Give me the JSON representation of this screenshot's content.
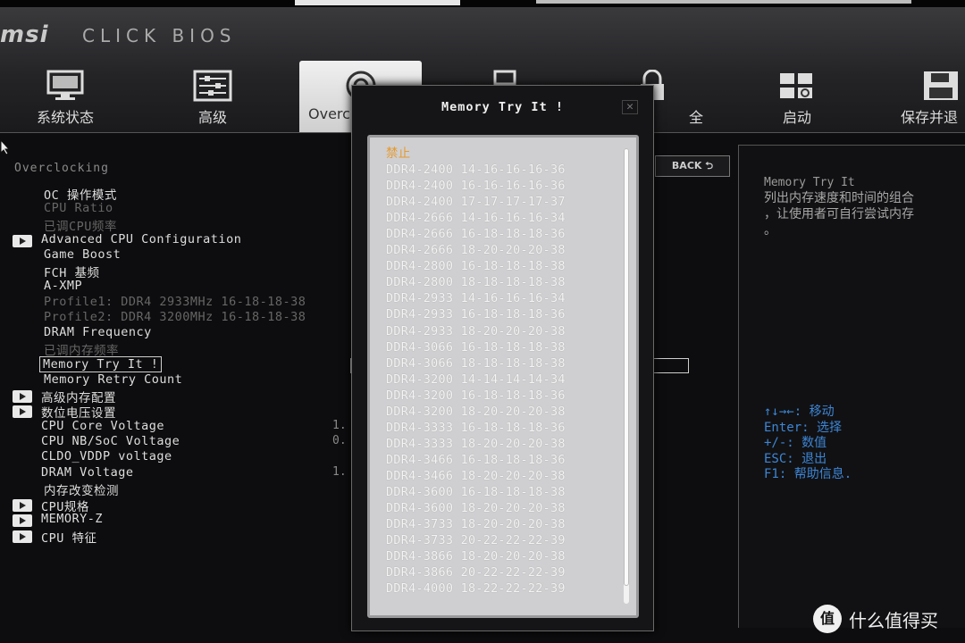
{
  "header": {
    "brand": "msi",
    "product": "CLICK BIOS",
    "tabs": [
      {
        "label": "系统状态",
        "icon": "monitor-icon"
      },
      {
        "label": "高级",
        "icon": "sliders-icon"
      },
      {
        "label": "Overc",
        "icon": "overclock-gauge-icon",
        "active": true
      },
      {
        "label": "",
        "icon": "chip-icon"
      },
      {
        "label": "全",
        "icon": "lock-icon"
      },
      {
        "label": "启动",
        "icon": "boot-grid-icon"
      },
      {
        "label": "保存并退",
        "icon": "floppy-disk-icon"
      }
    ]
  },
  "left": {
    "section_title": "Overclocking",
    "items": [
      {
        "label": "OC 操作模式"
      },
      {
        "label": "CPU Ratio",
        "dim": true
      },
      {
        "label": "已调CPU频率",
        "dim": true
      },
      {
        "label": "Advanced CPU Configuration",
        "submenu": true
      },
      {
        "label": "Game Boost"
      },
      {
        "label": "FCH 基频"
      },
      {
        "label": "A-XMP"
      },
      {
        "label": "Profile1: DDR4 2933MHz 16-18-18-38",
        "dim": true
      },
      {
        "label": "Profile2: DDR4 3200MHz 16-18-18-38",
        "dim": true
      },
      {
        "label": "DRAM Frequency"
      },
      {
        "label": "已调内存频率",
        "dim": true
      },
      {
        "label": "Memory Try It !",
        "selected": true
      },
      {
        "label": "Memory Retry Count"
      },
      {
        "label": "高级内存配置",
        "submenu": true
      },
      {
        "label": "数位电压设置",
        "submenu": true
      },
      {
        "label": "CPU Core Voltage",
        "value": "1."
      },
      {
        "label": "CPU NB/SoC Voltage",
        "value": "0."
      },
      {
        "label": "CLDO_VDDP voltage"
      },
      {
        "label": "DRAM Voltage",
        "value": "1."
      },
      {
        "label": "内存改变检测"
      },
      {
        "label": "CPU规格",
        "submenu": true
      },
      {
        "label": "MEMORY-Z",
        "submenu": true
      },
      {
        "label": "CPU 特征",
        "submenu": true
      }
    ]
  },
  "back_button": "BACK",
  "help": {
    "title": "Memory Try It",
    "description": "列出内存速度和时间的组合\n，让使用者可自行尝试内存\n。",
    "keys": "↑↓→←: 移动\nEnter: 选择\n+/-: 数值\nESC: 退出\nF1: 帮助信息."
  },
  "modal": {
    "title": "Memory Try It !",
    "close": "✕",
    "options": [
      "禁止",
      "DDR4-2400 14-16-16-16-36",
      "DDR4-2400 16-16-16-16-36",
      "DDR4-2400 17-17-17-17-37",
      "DDR4-2666 14-16-16-16-34",
      "DDR4-2666 16-18-18-18-36",
      "DDR4-2666 18-20-20-20-38",
      "DDR4-2800 16-18-18-18-38",
      "DDR4-2800 18-18-18-18-38",
      "DDR4-2933 14-16-16-16-34",
      "DDR4-2933 16-18-18-18-36",
      "DDR4-2933 18-20-20-20-38",
      "DDR4-3066 16-18-18-18-38",
      "DDR4-3066 18-18-18-18-38",
      "DDR4-3200 14-14-14-14-34",
      "DDR4-3200 16-18-18-18-36",
      "DDR4-3200 18-20-20-20-38",
      "DDR4-3333 16-18-18-18-36",
      "DDR4-3333 18-20-20-20-38",
      "DDR4-3466 16-18-18-18-36",
      "DDR4-3466 18-20-20-20-38",
      "DDR4-3600 16-18-18-18-38",
      "DDR4-3600 18-20-20-20-38",
      "DDR4-3733 18-20-20-20-38",
      "DDR4-3733 20-22-22-22-39",
      "DDR4-3866 18-20-20-20-38",
      "DDR4-3866 20-22-22-22-39",
      "DDR4-4000 18-22-22-22-39"
    ],
    "highlight_color": "#e59a2d"
  },
  "watermark": {
    "logo": "值",
    "text": "什么值得买"
  }
}
